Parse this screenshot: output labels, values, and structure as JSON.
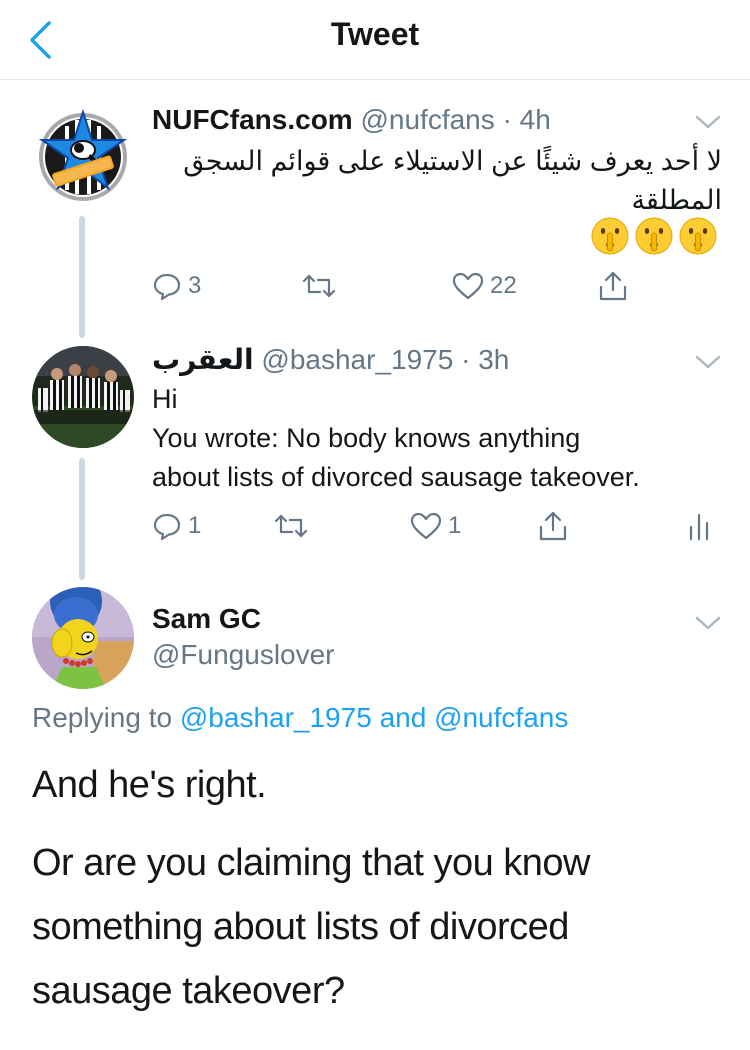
{
  "header": {
    "title": "Tweet"
  },
  "thread": [
    {
      "display_name": "NUFCfans.com",
      "handle": "@nufcfans",
      "separator": "·",
      "time": "4h",
      "text_line1": "لا أحد يعرف شيئًا عن الاستيلاء على قوائم السجق",
      "text_line2": "المطلقة",
      "emoji": [
        "shushing-face",
        "shushing-face",
        "shushing-face"
      ],
      "replies": "3",
      "retweets": "",
      "likes": "22"
    },
    {
      "display_name": "العقرب",
      "handle": "@bashar_1975",
      "separator": "·",
      "time": "3h",
      "text_line1": "Hi",
      "text_line2": "You wrote: No body knows anything",
      "text_line3": "about lists of divorced sausage takeover.",
      "replies": "1",
      "retweets": "",
      "likes": "1"
    }
  ],
  "main_tweet": {
    "display_name": "Sam GC",
    "handle": "@Funguslover",
    "replying_prefix": "Replying to",
    "replying_user1": "@bashar_1975",
    "replying_and": "and",
    "replying_user2": "@nufcfans",
    "para1": "And he's right.",
    "para2_line1": "Or are you claiming that you know",
    "para2_line2": "something about lists of divorced",
    "para2_line3": "sausage takeover?"
  },
  "colors": {
    "accent": "#1da1f2",
    "secondary_text": "#657786",
    "divider": "#e1e8ed",
    "thread_line": "#ccd6dd"
  }
}
